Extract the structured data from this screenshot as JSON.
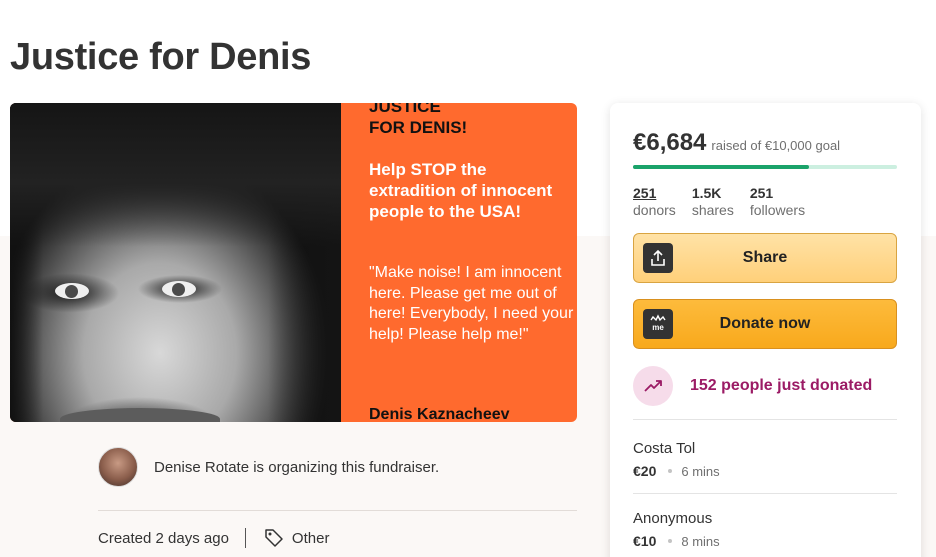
{
  "page": {
    "title": "Justice for Denis"
  },
  "hero": {
    "heading_line1": "JUSTICE",
    "heading_line2": "FOR DENIS!",
    "cta": "Help STOP the extradition of innocent people to the USA!",
    "quote": "\"Make noise! I am innocent here. Please get me out of here! Everybody, I need your help! Please help me!\"",
    "signature": "Denis Kaznacheev"
  },
  "organizer": {
    "text": "Denise Rotate is organizing this fundraiser."
  },
  "meta": {
    "created": "Created 2 days ago",
    "category": "Other"
  },
  "card": {
    "raised_amount": "€6,684",
    "raised_goal": "raised of €10,000 goal",
    "progress_fraction": 0.668,
    "stats": [
      {
        "value": "251",
        "label": "donors"
      },
      {
        "value": "1.5K",
        "label": "shares"
      },
      {
        "value": "251",
        "label": "followers"
      }
    ],
    "share_label": "Share",
    "donate_label": "Donate now",
    "momentum_text": "152 people just donated",
    "donations": [
      {
        "name": "Costa Tol",
        "amount": "€20",
        "time": "6 mins"
      },
      {
        "name": "Anonymous",
        "amount": "€10",
        "time": "8 mins"
      }
    ]
  },
  "colors": {
    "progress": "#1aa36a",
    "momentum": "#9b1b65",
    "donate_button": "#f8a91c",
    "hero_background": "#ff6a2e"
  }
}
